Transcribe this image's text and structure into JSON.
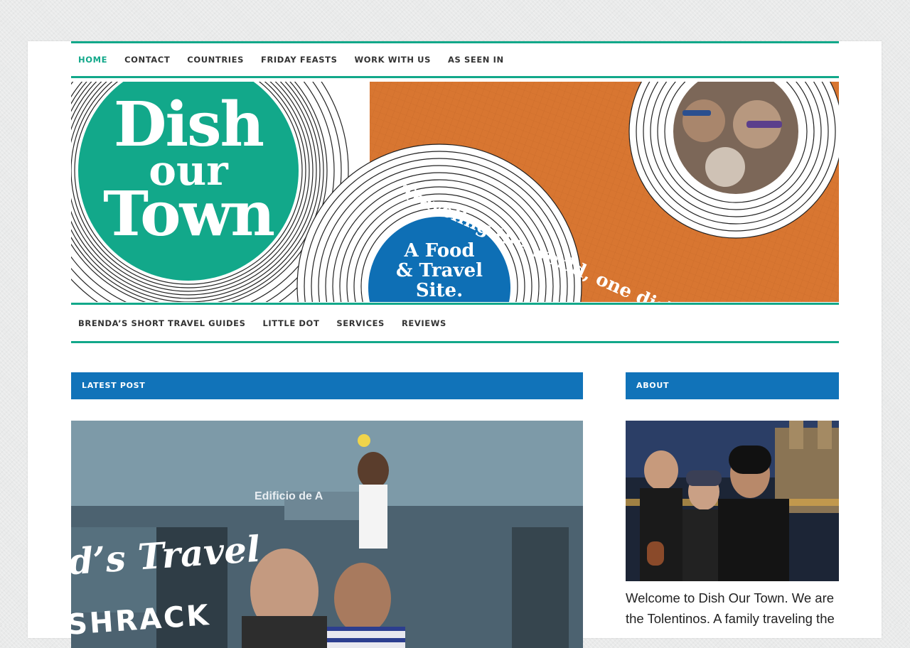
{
  "top_nav": {
    "items": [
      {
        "label": "HOME",
        "active": true
      },
      {
        "label": "CONTACT"
      },
      {
        "label": "COUNTRIES"
      },
      {
        "label": "FRIDAY FEASTS"
      },
      {
        "label": "WORK WITH US"
      },
      {
        "label": "AS SEEN IN"
      }
    ]
  },
  "banner": {
    "logo_line1": "Dish",
    "logo_line2": "our",
    "logo_line3": "Town",
    "tagline": "Traveling the world, one dish at a time.",
    "badge_line1": "A Food",
    "badge_line2": "& Travel",
    "badge_line3": "Site.",
    "colors": {
      "teal": "#12a88a",
      "orange": "#d87631",
      "blue": "#0e6fb5"
    }
  },
  "secondary_nav": {
    "items": [
      {
        "label": "BRENDA’S SHORT TRAVEL GUIDES"
      },
      {
        "label": "LITTLE DOT"
      },
      {
        "label": "SERVICES"
      },
      {
        "label": "REVIEWS"
      }
    ]
  },
  "main": {
    "section_title": "LATEST POST",
    "post_image_text_line1": "d’s Travel",
    "post_image_text_line2": "SHRACK",
    "post_image_sign": "Edificio de A"
  },
  "sidebar": {
    "section_title": "ABOUT",
    "about_text": "Welcome to Dish Our Town. We are the Tolentinos. A family traveling the"
  },
  "theme": {
    "accent": "#12a88a",
    "widget_blue": "#1173b9"
  }
}
